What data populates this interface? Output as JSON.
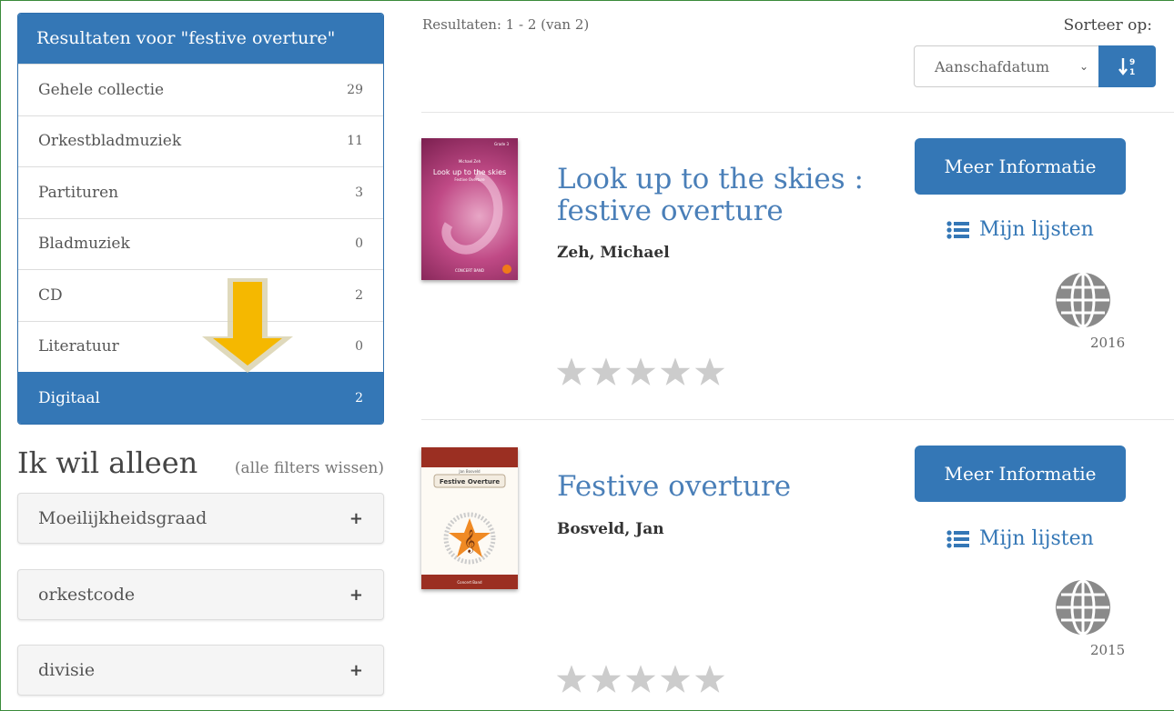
{
  "facets": {
    "heading": "Resultaten voor \"festive overture\"",
    "items": [
      {
        "label": "Gehele collectie",
        "count": "29"
      },
      {
        "label": "Orkestbladmuziek",
        "count": "11"
      },
      {
        "label": "Partituren",
        "count": "3"
      },
      {
        "label": "Bladmuziek",
        "count": "0"
      },
      {
        "label": "CD",
        "count": "2"
      },
      {
        "label": "Literatuur",
        "count": "0"
      },
      {
        "label": "Digitaal",
        "count": "2"
      }
    ]
  },
  "filters": {
    "title": "Ik wil alleen",
    "clear": "(alle filters wissen)",
    "groups": [
      {
        "label": "Moeilijkheidsgraad",
        "icon": "plus-icon"
      },
      {
        "label": "orkestcode",
        "icon": "plus-icon"
      },
      {
        "label": "divisie",
        "icon": "plus-icon"
      }
    ]
  },
  "results_header": {
    "count_text": "Resultaten: 1 - 2 (van 2)",
    "sort_label": "Sorteer op:",
    "sort_value": "Aanschafdatum"
  },
  "results": [
    {
      "title": "Look up to the skies : festive overture",
      "author": "Zeh, Michael",
      "more_label": "Meer Informatie",
      "lists_label": "Mijn lijsten",
      "year": "2016",
      "cover_title": "Look up to the skies",
      "cover_subtitle": "Festive Overture",
      "cover_composer": "Michael Zeh",
      "cover_grade": "Grade 3",
      "cover_footer": "CONCERT BAND",
      "rating": 0
    },
    {
      "title": "Festive overture",
      "author": "Bosveld, Jan",
      "more_label": "Meer Informatie",
      "lists_label": "Mijn lijsten",
      "year": "2015",
      "cover_title": "Festive Overture",
      "cover_composer": "Jan Bosveld",
      "cover_footer": "Concert Band",
      "rating": 0
    }
  ],
  "colors": {
    "primary": "#3477b6",
    "star_empty": "#cccccc",
    "arrow": "#f5b800"
  }
}
